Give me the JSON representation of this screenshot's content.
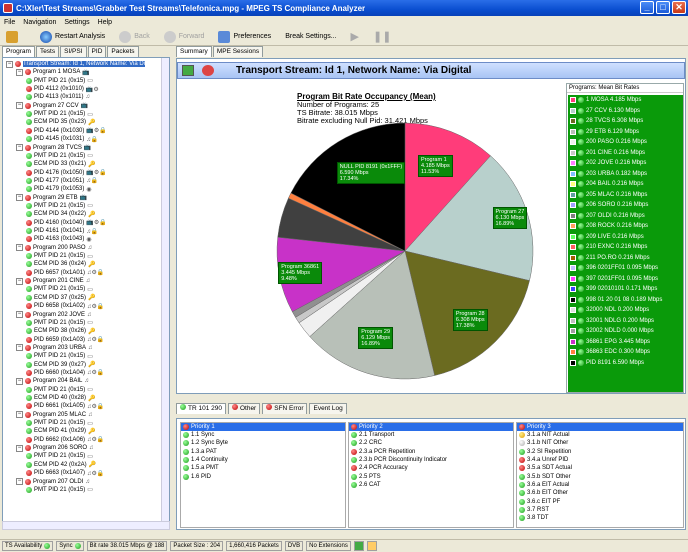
{
  "window": {
    "title": "C:\\Xler\\Test Streams\\Grabber Test Streams\\Telefonica.mpg - MPEG TS Compliance Analyzer",
    "min": "_",
    "max": "□",
    "close": "✕"
  },
  "menu": [
    "File",
    "Navigation",
    "Settings",
    "Help"
  ],
  "toolbar": {
    "restart": "Restart Analysis",
    "back": "Back",
    "forward": "Forward",
    "preferences": "Preferences",
    "break": "Break Settings..."
  },
  "left_tabs": [
    "Program",
    "Tests",
    "SI/PSI",
    "PID",
    "Packets"
  ],
  "tree": [
    {
      "d": 0,
      "c": "r",
      "t": "Transport Stream: Id 1, Network Name: Via Di",
      "sel": true
    },
    {
      "d": 1,
      "c": "r",
      "t": "Program 1 MOSA",
      "e": "📺"
    },
    {
      "d": 2,
      "c": "g",
      "t": "PMT PID 21 (0x15)",
      "e": "▭"
    },
    {
      "d": 2,
      "c": "r",
      "t": "PID 4112 (0x1010)",
      "e": "📺⚙"
    },
    {
      "d": 2,
      "c": "g",
      "t": "PID 4113 (0x1011)",
      "e": "♫"
    },
    {
      "d": 1,
      "c": "r",
      "t": "Program 27 CCV",
      "e": "📺"
    },
    {
      "d": 2,
      "c": "g",
      "t": "PMT PID 21 (0x15)",
      "e": "▭"
    },
    {
      "d": 2,
      "c": "g",
      "t": "ECM PID 35 (0x23)",
      "e": "🔑"
    },
    {
      "d": 2,
      "c": "r",
      "t": "PID 4144 (0x1030)",
      "e": "📺⚙🔒"
    },
    {
      "d": 2,
      "c": "g",
      "t": "PID 4145 (0x1031)",
      "e": "♫🔒"
    },
    {
      "d": 1,
      "c": "r",
      "t": "Program 28 TVCS",
      "e": "📺"
    },
    {
      "d": 2,
      "c": "g",
      "t": "PMT PID 21 (0x15)",
      "e": "▭"
    },
    {
      "d": 2,
      "c": "g",
      "t": "ECM PID 33 (0x21)",
      "e": "🔑"
    },
    {
      "d": 2,
      "c": "r",
      "t": "PID 4176 (0x1050)",
      "e": "📺⚙🔒"
    },
    {
      "d": 2,
      "c": "g",
      "t": "PID 4177 (0x1051)",
      "e": "♫🔒"
    },
    {
      "d": 2,
      "c": "g",
      "t": "PID 4179 (0x1053)",
      "e": "◉"
    },
    {
      "d": 1,
      "c": "r",
      "t": "Program 29 ETB",
      "e": "📺"
    },
    {
      "d": 2,
      "c": "g",
      "t": "PMT PID 21 (0x15)",
      "e": "▭"
    },
    {
      "d": 2,
      "c": "g",
      "t": "ECM PID 34 (0x22)",
      "e": "🔑"
    },
    {
      "d": 2,
      "c": "r",
      "t": "PID 4160 (0x1040)",
      "e": "📺⚙🔒"
    },
    {
      "d": 2,
      "c": "g",
      "t": "PID 4161 (0x1041)",
      "e": "♫🔒"
    },
    {
      "d": 2,
      "c": "r",
      "t": "PID 4163 (0x1043)",
      "e": "◉"
    },
    {
      "d": 1,
      "c": "r",
      "t": "Program 200 PASO",
      "e": "♫"
    },
    {
      "d": 2,
      "c": "g",
      "t": "PMT PID 21 (0x15)",
      "e": "▭"
    },
    {
      "d": 2,
      "c": "g",
      "t": "ECM PID 36 (0x24)",
      "e": "🔑"
    },
    {
      "d": 2,
      "c": "r",
      "t": "PID 6657 (0x1A01)",
      "e": "♫⚙🔒"
    },
    {
      "d": 1,
      "c": "r",
      "t": "Program 201 CINE",
      "e": "♫"
    },
    {
      "d": 2,
      "c": "g",
      "t": "PMT PID 21 (0x15)",
      "e": "▭"
    },
    {
      "d": 2,
      "c": "g",
      "t": "ECM PID 37 (0x25)",
      "e": "🔑"
    },
    {
      "d": 2,
      "c": "r",
      "t": "PID 6658 (0x1A02)",
      "e": "♫⚙🔒"
    },
    {
      "d": 1,
      "c": "r",
      "t": "Program 202 JOVE",
      "e": "♫"
    },
    {
      "d": 2,
      "c": "g",
      "t": "PMT PID 21 (0x15)",
      "e": "▭"
    },
    {
      "d": 2,
      "c": "g",
      "t": "ECM PID 38 (0x26)",
      "e": "🔑"
    },
    {
      "d": 2,
      "c": "r",
      "t": "PID 6659 (0x1A03)",
      "e": "♫⚙🔒"
    },
    {
      "d": 1,
      "c": "r",
      "t": "Program 203 URBA",
      "e": "♫"
    },
    {
      "d": 2,
      "c": "g",
      "t": "PMT PID 21 (0x15)",
      "e": "▭"
    },
    {
      "d": 2,
      "c": "g",
      "t": "ECM PID 39 (0x27)",
      "e": "🔑"
    },
    {
      "d": 2,
      "c": "r",
      "t": "PID 6660 (0x1A04)",
      "e": "♫⚙🔒"
    },
    {
      "d": 1,
      "c": "r",
      "t": "Program 204 BAIL",
      "e": "♫"
    },
    {
      "d": 2,
      "c": "g",
      "t": "PMT PID 21 (0x15)",
      "e": "▭"
    },
    {
      "d": 2,
      "c": "g",
      "t": "ECM PID 40 (0x28)",
      "e": "🔑"
    },
    {
      "d": 2,
      "c": "r",
      "t": "PID 6661 (0x1A05)",
      "e": "♫⚙🔒"
    },
    {
      "d": 1,
      "c": "r",
      "t": "Program 205 MLAC",
      "e": "♫"
    },
    {
      "d": 2,
      "c": "g",
      "t": "PMT PID 21 (0x15)",
      "e": "▭"
    },
    {
      "d": 2,
      "c": "g",
      "t": "ECM PID 41 (0x29)",
      "e": "🔑"
    },
    {
      "d": 2,
      "c": "r",
      "t": "PID 6662 (0x1A06)",
      "e": "♫⚙🔒"
    },
    {
      "d": 1,
      "c": "r",
      "t": "Program 206 SORO",
      "e": "♫"
    },
    {
      "d": 2,
      "c": "g",
      "t": "PMT PID 21 (0x15)",
      "e": "▭"
    },
    {
      "d": 2,
      "c": "g",
      "t": "ECM PID 42 (0x2A)",
      "e": "🔑"
    },
    {
      "d": 2,
      "c": "r",
      "t": "PID 6663 (0x1A07)",
      "e": "♫⚙🔒"
    },
    {
      "d": 1,
      "c": "r",
      "t": "Program 207 OLDI",
      "e": "♫"
    },
    {
      "d": 2,
      "c": "g",
      "t": "PMT PID 21 (0x15)",
      "e": "▭"
    }
  ],
  "right_tabs": [
    "Summary",
    "MPE Sessions"
  ],
  "ts_header": "Transport Stream: Id 1, Network Name: Via Digital",
  "chart_text": {
    "title": "Program Bit Rate Occupancy (Mean)",
    "line1": "Number of Programs: 25",
    "line2": "TS Bitrate: 38.015 Mbps",
    "line3": "Bitrate excluding Null Pid: 31.421 Mbps"
  },
  "chart_data": {
    "type": "pie",
    "title": "Program Bit Rate Occupancy (Mean)",
    "slices": [
      {
        "name": "Program 1",
        "mbps": 4.185,
        "pct": 11.53,
        "color": "#ff3c7a",
        "label": true
      },
      {
        "name": "Program 27",
        "mbps": 6.13,
        "pct": 16.89,
        "color": "#b8d0cc",
        "label": true
      },
      {
        "name": "Program 28",
        "mbps": 6.308,
        "pct": 17.38,
        "color": "#6b6b20",
        "label": true
      },
      {
        "name": "Program 29",
        "mbps": 6.129,
        "pct": 16.89,
        "color": "#b8c0b8",
        "label": true
      },
      {
        "name": "small",
        "pct": 2.15,
        "color": "#f0f0f0",
        "label": false
      },
      {
        "name": "small2",
        "pct": 0.8,
        "color": "#c8c8c8",
        "label": false
      },
      {
        "name": "small3",
        "pct": 0.8,
        "color": "#909090",
        "label": false
      },
      {
        "name": "Program 36861",
        "mbps": 3.445,
        "pct": 9.48,
        "color": "#c832c8",
        "label": true
      },
      {
        "name": "small4",
        "pct": 5.0,
        "color": "#404040",
        "label": false
      },
      {
        "name": "small5",
        "pct": 0.7,
        "color": "#ff8040",
        "label": false
      },
      {
        "name": "NULL PID 8191 (0x1FFF)",
        "mbps": 6.59,
        "pct": 17.34,
        "color": "#000000",
        "label": true
      }
    ],
    "labels": {
      "p1": "Program 1\n4.185 Mbps\n11.53%",
      "p27": "Program 27\n6.130 Mbps\n16.89%",
      "p28": "Program 28\n6.308 Mbps\n17.38%",
      "p29": "Program 29\n6.129 Mbps\n16.89%",
      "p36861": "Program 36861\n3.445 Mbps\n9.48%",
      "null": "NULL PID 8191 (0x1FFF)\n6.590 Mbps\n17.34%"
    }
  },
  "legend": {
    "title": "Programs: Mean Bit Rates",
    "items": [
      {
        "t": "1 MOSA  4.185 Mbps",
        "c": "#ff3c7a"
      },
      {
        "t": "27 CCV  6.130 Mbps",
        "c": "#b8d0cc"
      },
      {
        "t": "28 TVCS  6.308 Mbps",
        "c": "#6b6b20"
      },
      {
        "t": "29 ETB  6.129 Mbps",
        "c": "#b8c0b8"
      },
      {
        "t": "200 PASO  0.216 Mbps",
        "c": "#f0f0f0"
      },
      {
        "t": "201 CINE  0.216 Mbps",
        "c": "#c8c8c8"
      },
      {
        "t": "202 JOVE  0.216 Mbps",
        "c": "#ff80ff"
      },
      {
        "t": "203 URBA  0.182 Mbps",
        "c": "#80c0ff"
      },
      {
        "t": "204 BAIL  0.216 Mbps",
        "c": "#ffff80"
      },
      {
        "t": "205 MLAC  0.216 Mbps",
        "c": "#60a0a0"
      },
      {
        "t": "206 SORO  0.216 Mbps",
        "c": "#a0a0ff"
      },
      {
        "t": "207 OLDI  0.216 Mbps",
        "c": "#808080"
      },
      {
        "t": "208 ROCK  0.216 Mbps",
        "c": "#ffa060"
      },
      {
        "t": "209 LIVE  0.216 Mbps",
        "c": "#60ff60"
      },
      {
        "t": "210 EXNC  0.216 Mbps",
        "c": "#ff6060"
      },
      {
        "t": "211 PO.RO  0.216 Mbps",
        "c": "#a06000"
      },
      {
        "t": "396 0201FF01  0.095 Mbps",
        "c": "#c0c0ff"
      },
      {
        "t": "397 0201FF01  0.095 Mbps",
        "c": "#ff40ff"
      },
      {
        "t": "399 02010101  0.171 Mbps",
        "c": "#4040ff"
      },
      {
        "t": "998 01 20 01 08  0.189 Mbps",
        "c": "#000000"
      },
      {
        "t": "32000 NDL  0.200 Mbps",
        "c": "#e0e0e0"
      },
      {
        "t": "32001 NDLG  0.200 Mbps",
        "c": "#c0c0c0"
      },
      {
        "t": "32002 NDLD  0.000 Mbps",
        "c": "#a0a0a0"
      },
      {
        "t": "36861 EPG  3.445 Mbps",
        "c": "#c832c8"
      },
      {
        "t": "36863 EDC  0.300 Mbps",
        "c": "#ff8040"
      },
      {
        "t": "PID 8191 6.590 Mbps",
        "c": "#000000"
      }
    ]
  },
  "bottom_tabs": [
    "TR 101 290",
    "Other",
    "SFN Error",
    "Event Log"
  ],
  "priority1": {
    "title": "Priority 1",
    "items": [
      {
        "t": "1.1 Sync",
        "c": "g"
      },
      {
        "t": "1.2 Sync Byte",
        "c": "g"
      },
      {
        "t": "1.3.a PAT",
        "c": "g"
      },
      {
        "t": "1.4 Continuity",
        "c": "g"
      },
      {
        "t": "1.5.a PMT",
        "c": "g"
      },
      {
        "t": "1.6 PID",
        "c": "g"
      }
    ]
  },
  "priority2": {
    "title": "Priority 2",
    "items": [
      {
        "t": "2.1 Transport",
        "c": "g"
      },
      {
        "t": "2.2 CRC",
        "c": "g"
      },
      {
        "t": "2.3.a PCR Repetition",
        "c": "r"
      },
      {
        "t": "2.3.b PCR Discontinuity Indicator",
        "c": "g"
      },
      {
        "t": "2.4 PCR Accuracy",
        "c": "r"
      },
      {
        "t": "2.5 PTS",
        "c": "g"
      },
      {
        "t": "2.6 CAT",
        "c": "g"
      }
    ]
  },
  "priority3": {
    "title": "Priority 3",
    "items": [
      {
        "t": "3.1.a NIT Actual",
        "c": "o"
      },
      {
        "t": "3.1.b NIT Other",
        "c": "w"
      },
      {
        "t": "3.2 SI Repetition",
        "c": "g"
      },
      {
        "t": "3.4.a Unref PID",
        "c": "r"
      },
      {
        "t": "3.5.a SDT Actual",
        "c": "r"
      },
      {
        "t": "3.5.b SDT Other",
        "c": "g"
      },
      {
        "t": "3.6.a EIT Actual",
        "c": "g"
      },
      {
        "t": "3.6.b EIT Other",
        "c": "g"
      },
      {
        "t": "3.6.c EIT PF",
        "c": "g"
      },
      {
        "t": "3.7 RST",
        "c": "g"
      },
      {
        "t": "3.8 TDT",
        "c": "g"
      }
    ]
  },
  "status": {
    "ts": "TS Availability",
    "sync": "Sync",
    "bitrate": "Bit rate 38.015 Mbps @ 188",
    "packet": "Packet Size : 204",
    "packets": "1,660,416 Packets",
    "dvb": "DVB",
    "ext": "No Extensions"
  }
}
